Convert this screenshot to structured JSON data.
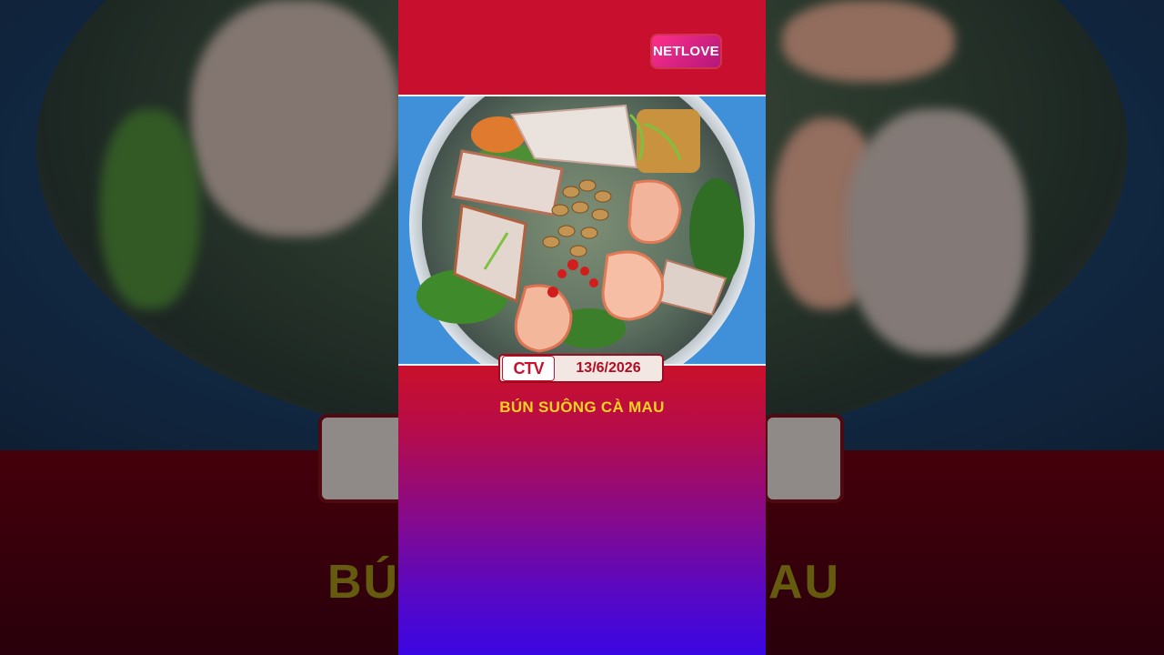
{
  "channel_logo": {
    "text": "NETLOVE"
  },
  "badge": {
    "station": "CTV",
    "date": "13/6/2026"
  },
  "title": "BÚN SUÔNG CÀ MAU",
  "image": {
    "subject": "bowl-of-bun-suong-noodle-soup"
  },
  "colors": {
    "brand_red": "#c8102e",
    "title_yellow": "#ffd21f",
    "gradient_end": "#3a06e2",
    "logo_pink": "#ff2f8a"
  }
}
